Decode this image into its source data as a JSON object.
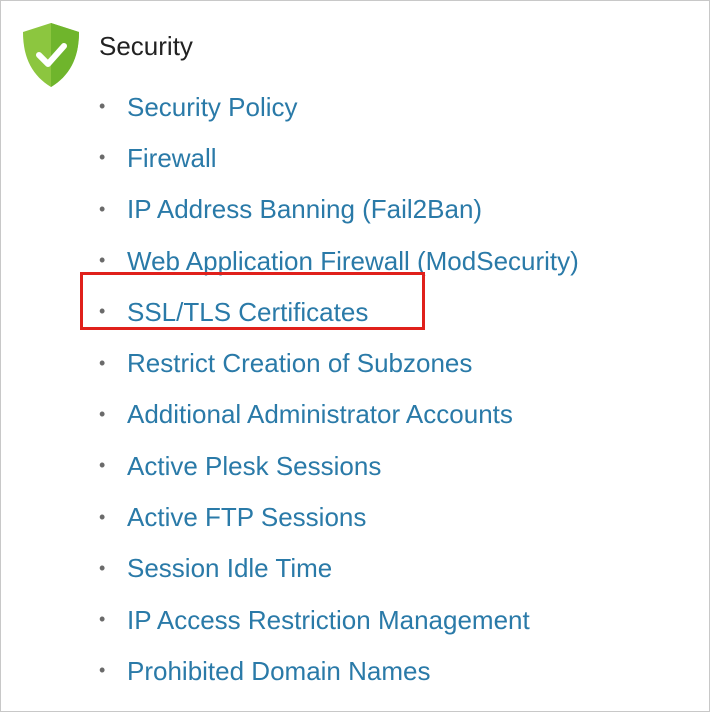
{
  "section": {
    "title": "Security",
    "icon": "shield-check-icon",
    "icon_color": "#7ac943",
    "links": [
      {
        "label": "Security Policy"
      },
      {
        "label": "Firewall"
      },
      {
        "label": "IP Address Banning (Fail2Ban)"
      },
      {
        "label": "Web Application Firewall (ModSecurity)"
      },
      {
        "label": "SSL/TLS Certificates",
        "highlighted": true
      },
      {
        "label": "Restrict Creation of Subzones"
      },
      {
        "label": "Additional Administrator Accounts"
      },
      {
        "label": "Active Plesk Sessions"
      },
      {
        "label": "Active FTP Sessions"
      },
      {
        "label": "Session Idle Time"
      },
      {
        "label": "IP Access Restriction Management"
      },
      {
        "label": "Prohibited Domain Names"
      }
    ]
  },
  "colors": {
    "link": "#2a7aa8",
    "heading": "#222222",
    "highlight_border": "#e0201b"
  }
}
